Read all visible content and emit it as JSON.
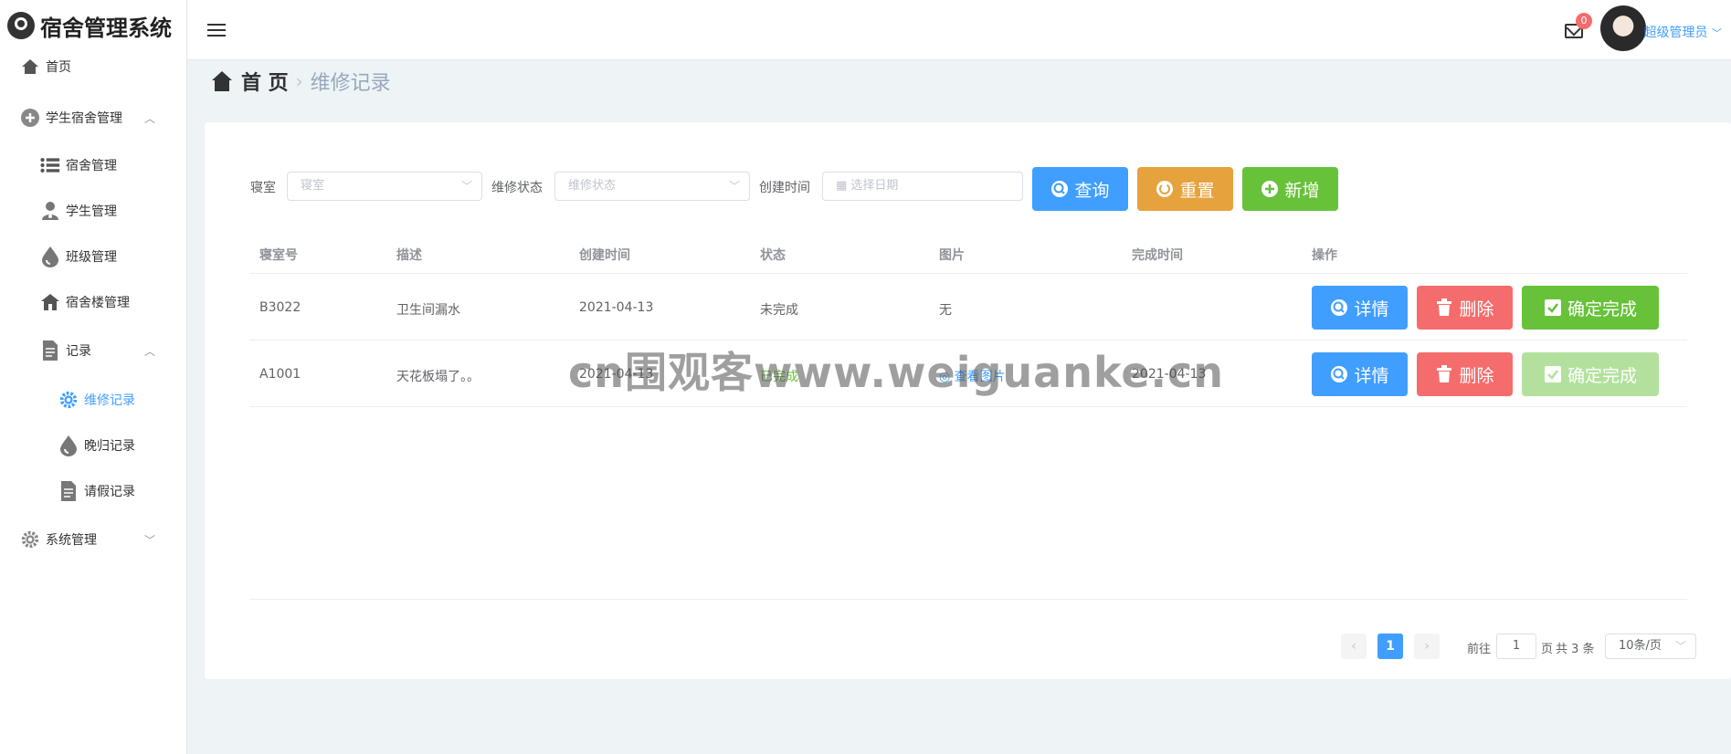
{
  "app": {
    "title": "宿舍管理系统"
  },
  "sidebar": {
    "items": [
      {
        "label": "首页"
      },
      {
        "label": "学生宿舍管理"
      },
      {
        "label": "宿舍管理"
      },
      {
        "label": "学生管理"
      },
      {
        "label": "班级管理"
      },
      {
        "label": "宿舍楼管理"
      },
      {
        "label": "记录"
      },
      {
        "label": "维修记录"
      },
      {
        "label": "晚归记录"
      },
      {
        "label": "请假记录"
      },
      {
        "label": "系统管理"
      }
    ]
  },
  "header": {
    "badge_count": "0",
    "user_name": "超级管理员"
  },
  "breadcrumb": {
    "home": "首 页",
    "separator": "›",
    "current": "维修记录"
  },
  "filters": {
    "dorm_label": "寝室",
    "dorm_placeholder": "寝室",
    "status_label": "维修状态",
    "status_placeholder": "维修状态",
    "created_label": "创建时间",
    "created_placeholder": "选择日期",
    "query_button": "查询",
    "reset_button": "重置",
    "add_button": "新增"
  },
  "table": {
    "headers": [
      "寝室号",
      "描述",
      "创建时间",
      "状态",
      "图片",
      "完成时间",
      "操作"
    ],
    "rows": [
      {
        "dorm": "B3022",
        "description": "卫生间漏水",
        "created": "2021-04-13",
        "status": "未完成",
        "image": "无",
        "finished": ""
      },
      {
        "dorm": "A1001",
        "description": "天花板塌了。。",
        "created": "2021-04-13",
        "status": "已完成",
        "image": "查看图片",
        "finished": "2021-04-13"
      }
    ],
    "actions": {
      "detail": "详情",
      "delete": "删除",
      "confirm": "确定完成"
    }
  },
  "pagination": {
    "prev": "‹",
    "current": "1",
    "next": "›",
    "goto_label": "前往",
    "goto_value": "1",
    "page_suffix": "页",
    "total_text": "共 3 条",
    "page_size": "10条/页"
  },
  "watermark": "cn围观客www.weiguanke.cn",
  "colors": {
    "primary": "#409eff",
    "warning": "#e6a23c",
    "success": "#67c23a",
    "danger": "#f56c6c"
  }
}
